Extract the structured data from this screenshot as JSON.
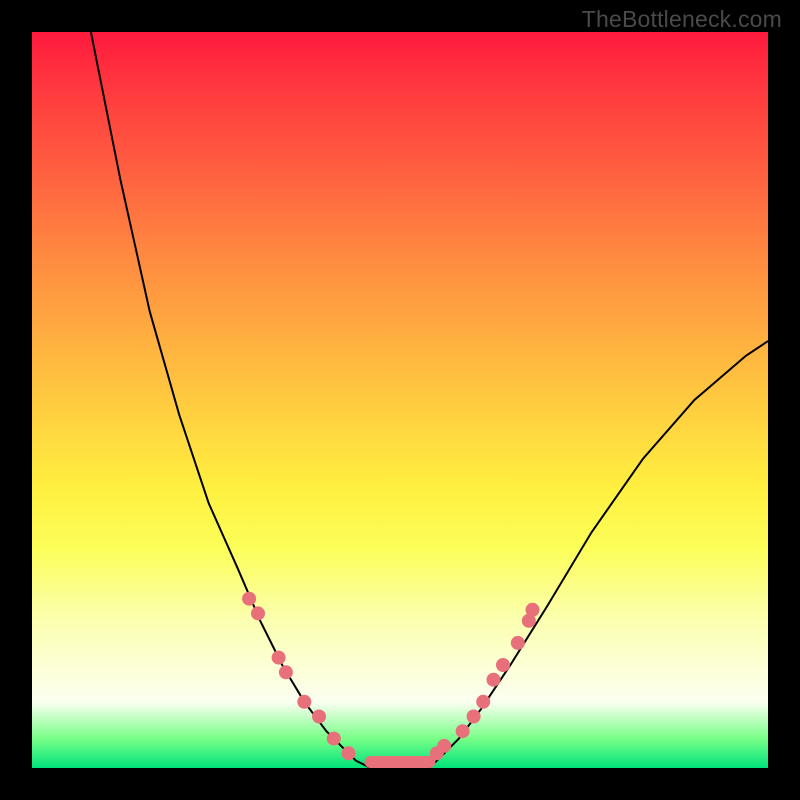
{
  "watermark_text": "TheBottleneck.com",
  "chart_data": {
    "type": "line",
    "title": "",
    "xlabel": "",
    "ylabel": "",
    "xlim": [
      0,
      100
    ],
    "ylim": [
      0,
      100
    ],
    "series": [
      {
        "name": "left-curve",
        "x": [
          8,
          12,
          16,
          20,
          24,
          28,
          31,
          34,
          37,
          40,
          42,
          44,
          46
        ],
        "y": [
          100,
          80,
          62,
          48,
          36,
          27,
          20,
          14,
          9,
          5,
          3,
          1,
          0
        ]
      },
      {
        "name": "right-curve",
        "x": [
          54,
          56,
          58,
          61,
          65,
          70,
          76,
          83,
          90,
          97,
          100
        ],
        "y": [
          0,
          2,
          4,
          8,
          14,
          22,
          32,
          42,
          50,
          56,
          58
        ]
      }
    ],
    "valley_floor": {
      "x_start": 46,
      "x_end": 54,
      "y": 0
    },
    "left_dots": [
      {
        "x": 29.5,
        "y": 23
      },
      {
        "x": 30.7,
        "y": 21
      },
      {
        "x": 33.5,
        "y": 15
      },
      {
        "x": 34.5,
        "y": 13
      },
      {
        "x": 37.0,
        "y": 9
      },
      {
        "x": 39.0,
        "y": 7
      },
      {
        "x": 41.0,
        "y": 4
      },
      {
        "x": 43.0,
        "y": 2
      }
    ],
    "right_dots": [
      {
        "x": 55.0,
        "y": 2
      },
      {
        "x": 56.0,
        "y": 3
      },
      {
        "x": 58.5,
        "y": 5
      },
      {
        "x": 60.0,
        "y": 7
      },
      {
        "x": 61.3,
        "y": 9
      },
      {
        "x": 62.7,
        "y": 12
      },
      {
        "x": 64.0,
        "y": 14
      },
      {
        "x": 66.0,
        "y": 17
      },
      {
        "x": 67.5,
        "y": 20
      },
      {
        "x": 68.0,
        "y": 21.5
      }
    ],
    "colors": {
      "gradient_top": "#ff1a3d",
      "gradient_mid": "#fff040",
      "gradient_bottom": "#00e27a",
      "curve": "#000000",
      "dot": "#e8707a",
      "frame": "#000000"
    }
  }
}
